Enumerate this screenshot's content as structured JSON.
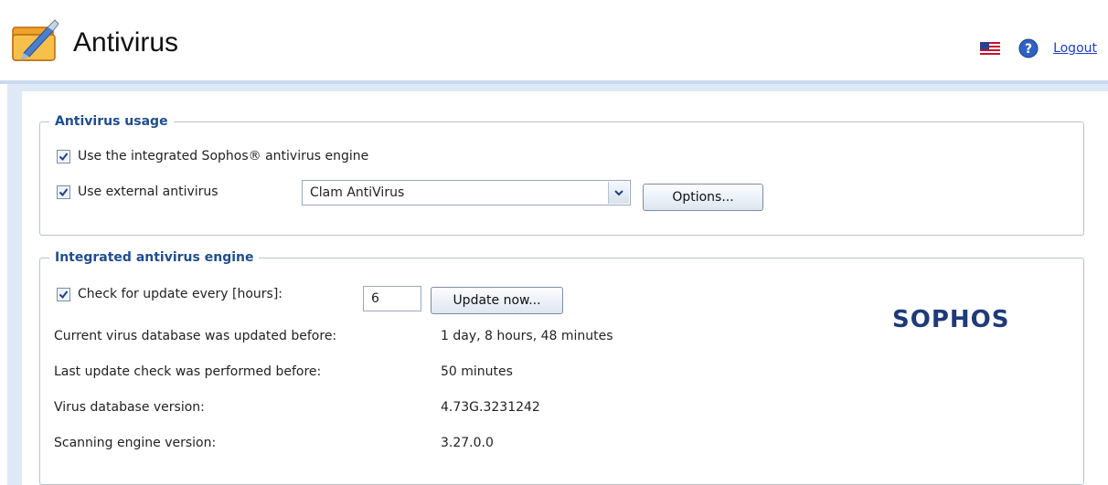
{
  "header": {
    "title": "Antivirus",
    "logout_label": "Logout"
  },
  "usage": {
    "legend": "Antivirus usage",
    "integrated_label": "Use the integrated Sophos® antivirus engine",
    "integrated_checked": true,
    "external_label": "Use external antivirus",
    "external_checked": true,
    "external_selected": "Clam AntiVirus",
    "options_label": "Options..."
  },
  "engine": {
    "legend": "Integrated antivirus engine",
    "check_label": "Check for update every [hours]:",
    "check_checked": true,
    "hours_value": "6",
    "update_label": "Update now...",
    "logo_text": "SOPHOS",
    "info": [
      {
        "label": "Current virus database was updated before:",
        "value": "1 day, 8 hours, 48 minutes"
      },
      {
        "label": "Last update check was performed before:",
        "value": "50 minutes"
      },
      {
        "label": "Virus database version:",
        "value": "4.73G.3231242"
      },
      {
        "label": "Scanning engine version:",
        "value": "3.27.0.0"
      }
    ]
  },
  "colors": {
    "accent": "#1f4d91",
    "panel_bg": "#dfe8f6",
    "link": "#1a3fcc",
    "logo": "#1e3a78"
  },
  "icons": [
    "antivirus-app-icon",
    "us-flag-icon",
    "help-icon",
    "checkbox-checked-icon",
    "dropdown-arrow-icon"
  ]
}
